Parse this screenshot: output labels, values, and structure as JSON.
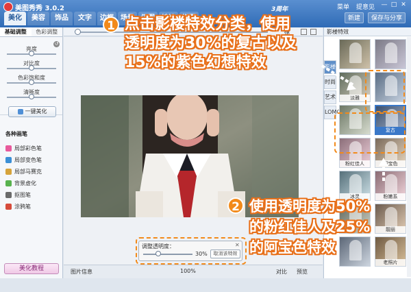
{
  "app": {
    "title": "美图秀秀 3.0.2",
    "anniversary": "3周年"
  },
  "title_links": [
    "菜单",
    "提意见"
  ],
  "window_buttons": [
    "—",
    "□",
    "✕"
  ],
  "main_tabs": [
    "美化",
    "美容",
    "饰品",
    "文字",
    "边框",
    "场景",
    "闪图",
    "娃娃",
    "拼图"
  ],
  "top_actions": {
    "new": "新建",
    "save_share": "保存与分享"
  },
  "left_panel": {
    "tabs": [
      "基础调整",
      "色彩调整"
    ],
    "sliders": [
      "亮度",
      "对比度",
      "色彩饱和度",
      "清晰度"
    ],
    "slider_levels": [
      0.5,
      0.5,
      0.5,
      0.5
    ],
    "one_click": "一键美化",
    "brushes_title": "各种画笔",
    "brushes": [
      {
        "label": "局部彩色笔",
        "color": "#e85a9c"
      },
      {
        "label": "局部变色笔",
        "color": "#3b8fd6"
      },
      {
        "label": "局部马赛克",
        "color": "#d6a33b"
      },
      {
        "label": "背景虚化",
        "color": "#58b24e"
      },
      {
        "label": "抠图笔",
        "color": "#6a6a6a"
      },
      {
        "label": "涂鸦笔",
        "color": "#d64b3b"
      }
    ],
    "tutorial": "美化教程"
  },
  "toolbar": {
    "label": "橡"
  },
  "bottom_bar": {
    "image_info": "图片信息",
    "zoom": "100%",
    "compare": "对比",
    "preview": "预览"
  },
  "popup": {
    "title": "调整透明度：",
    "value": "30%",
    "cancel": "取消该特效",
    "close": "✕"
  },
  "right_panel": {
    "header": "影楼特效",
    "side_tabs": [
      "影楼",
      "时尚",
      "艺术",
      "LOMO"
    ],
    "thumbs": [
      {
        "label": "",
        "selected": false
      },
      {
        "label": "",
        "selected": false
      },
      {
        "label": "淡雅",
        "selected": false
      },
      {
        "label": "",
        "selected": false
      },
      {
        "label": "",
        "selected": false
      },
      {
        "label": "复古",
        "selected": true
      },
      {
        "label": "粉红佳人",
        "selected": false
      },
      {
        "label": "阿宝色",
        "selected": false
      },
      {
        "label": "冰灵",
        "selected": false
      },
      {
        "label": "粉嫩系",
        "selected": false
      },
      {
        "label": "",
        "selected": false
      },
      {
        "label": "靓丽",
        "selected": false
      },
      {
        "label": "",
        "selected": false
      },
      {
        "label": "老照片",
        "selected": false
      }
    ]
  },
  "instructions": {
    "step1_number": "1",
    "step1_lines": [
      "点击影楼特效分类，使用",
      "透明度为30%的复古以及",
      "15%的紫色幻想特效"
    ],
    "step2_number": "2",
    "step2_lines": [
      "使用透明度为50%",
      "的粉红佳人及25%",
      "的阿宝色特效"
    ]
  },
  "colors": {
    "accent": "#f28a1a",
    "titlebar": "#2f6bb6",
    "selected": "#3a78c8"
  }
}
